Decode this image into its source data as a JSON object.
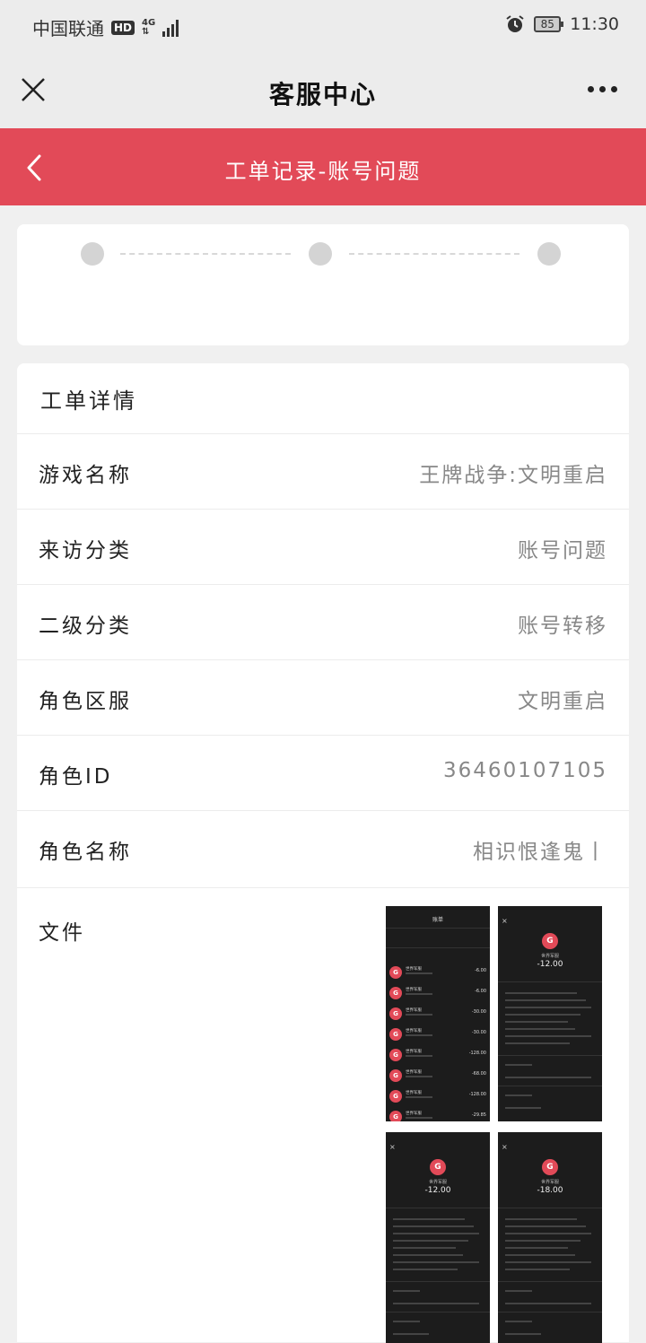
{
  "status_bar": {
    "carrier": "中国联通",
    "hd": "HD",
    "network_top": "4G",
    "network_bottom": "⇅",
    "battery": "85",
    "time": "11:30",
    "alarm_icon": "alarm-clock-icon"
  },
  "title_bar": {
    "title": "客服中心",
    "close_icon": "close-icon",
    "more_icon": "more-horizontal-icon"
  },
  "header": {
    "title": "工单记录-账号问题",
    "back_icon": "chevron-left-icon",
    "color": "#e24a58"
  },
  "progress": {
    "steps": 3
  },
  "details": {
    "title": "工单详情",
    "rows": [
      {
        "label": "游戏名称",
        "value": "王牌战争:文明重启"
      },
      {
        "label": "来访分类",
        "value": "账号问题"
      },
      {
        "label": "二级分类",
        "value": "账号转移"
      },
      {
        "label": "角色区服",
        "value": "文明重启"
      },
      {
        "label": "角色ID",
        "value": "36460107105"
      },
      {
        "label": "角色名称",
        "value": "相识恨逢鬼丨"
      }
    ],
    "file_label": "文件"
  },
  "attachments": [
    {
      "kind": "list",
      "header": "账单",
      "rows": [
        {
          "name": "世界军服",
          "amount": "-6.00"
        },
        {
          "name": "世界军服",
          "amount": "-6.00"
        },
        {
          "name": "世界军服",
          "amount": "-30.00"
        },
        {
          "name": "世界军服",
          "amount": "-30.00"
        },
        {
          "name": "世界军服",
          "amount": "-128.00"
        },
        {
          "name": "世界军服",
          "amount": "-68.00"
        },
        {
          "name": "世界军服",
          "amount": "-128.00"
        },
        {
          "name": "世界军服",
          "amount": "-29.85"
        }
      ]
    },
    {
      "kind": "detail",
      "name": "世界军服",
      "amount": "-12.00"
    },
    {
      "kind": "detail",
      "name": "世界军服",
      "amount": "-12.00"
    },
    {
      "kind": "detail",
      "name": "世界军服",
      "amount": "-18.00"
    }
  ]
}
